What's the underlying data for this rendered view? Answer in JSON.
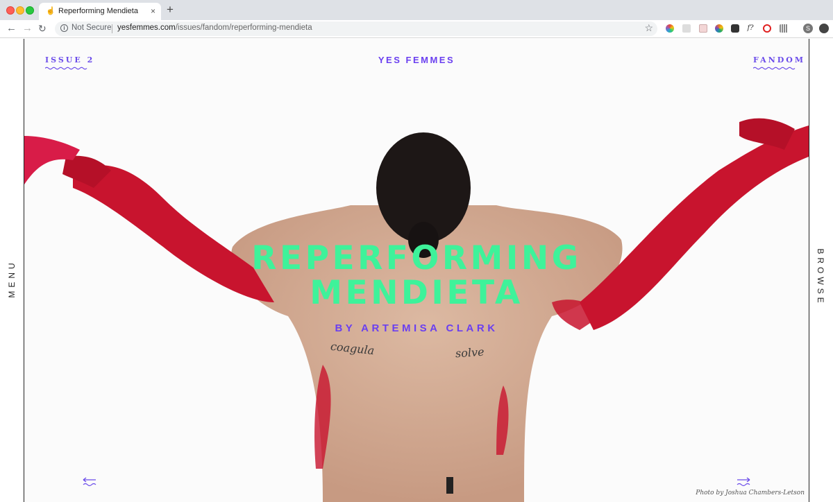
{
  "browser": {
    "tab_title": "Reperforming Mendieta",
    "tab_close": "×",
    "new_tab": "+",
    "security_label": "Not Secure",
    "url_host": "yesfemmes.com",
    "url_path": "/issues/fandom/reperforming-mendieta",
    "profile_initial": "S",
    "extensions": [
      {
        "icon": "color-wheel-icon",
        "color": "#e74c3c"
      },
      {
        "icon": "page-icon",
        "color": "#bbbbbb"
      },
      {
        "icon": "tag-icon",
        "color": "#e0a0a0"
      },
      {
        "icon": "palette-icon",
        "color": "#e67e22"
      },
      {
        "icon": "cube-icon",
        "color": "#444444"
      },
      {
        "icon": "font-icon",
        "color": "#333333",
        "text": "f?"
      },
      {
        "icon": "blocker-icon",
        "color": "#e02020"
      },
      {
        "icon": "barcode-icon",
        "color": "#999999"
      }
    ]
  },
  "site": {
    "name": "YES FEMMES",
    "issue_label": "ISSUE 2",
    "section_label": "FANDOM",
    "menu_label": "MENU",
    "browse_label": "BROWSE"
  },
  "article": {
    "title_line1": "REPERFORMING",
    "title_line2": "MENDIETA",
    "byline": "BY ARTEMISA CLARK",
    "photo_credit": "Photo by Joshua Chambers-Letson",
    "tattoo_left": "coagula",
    "tattoo_right": "solve"
  },
  "colors": {
    "accent_purple": "#6a3ff0",
    "headline_green": "#3ef29a",
    "paint_red": "#c8142e"
  }
}
